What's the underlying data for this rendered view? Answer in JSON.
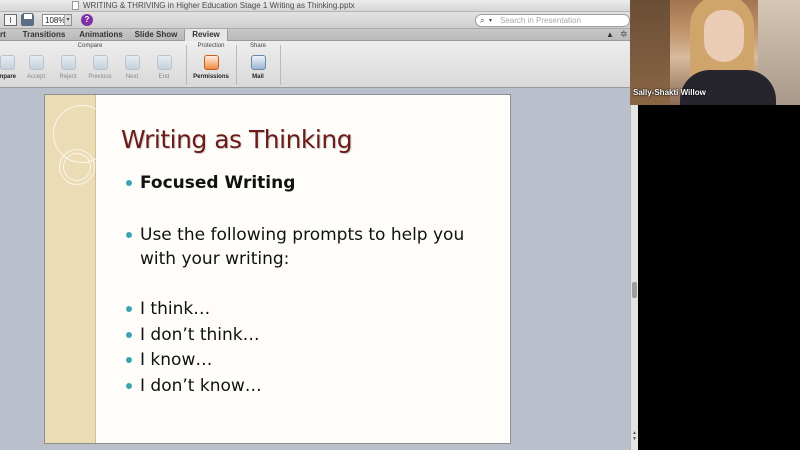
{
  "window": {
    "title": "WRITING & THRIVING in Higher Education Stage 1 Writing as Thinking.pptx"
  },
  "toolbar": {
    "zoom": "108%",
    "search_placeholder": "Search in Presentation"
  },
  "tabs": [
    "rt",
    "Transitions",
    "Animations",
    "Slide Show",
    "Review"
  ],
  "active_tab": "Review",
  "ribbon": {
    "groups": {
      "compare": "Compare",
      "protection": "Protection",
      "share": "Share"
    },
    "compare_buttons": [
      "mpare",
      "Accept",
      "Reject",
      "Previous",
      "Next",
      "End"
    ],
    "permissions_label": "Permissions",
    "mail_label": "Mail"
  },
  "slide": {
    "title": "Writing as Thinking",
    "bullets": [
      "Focused Writing",
      "Use the following prompts to help you",
      "with your writing:",
      "I think…",
      "I don’t think…",
      "I know…",
      "I don’t know…"
    ]
  },
  "video": {
    "participant_name": "Sally-Shakti Willow"
  },
  "colors": {
    "title": "#6b1b18",
    "bullet_dot": "#3ea3b0",
    "slide_band": "#ecdcb5"
  }
}
